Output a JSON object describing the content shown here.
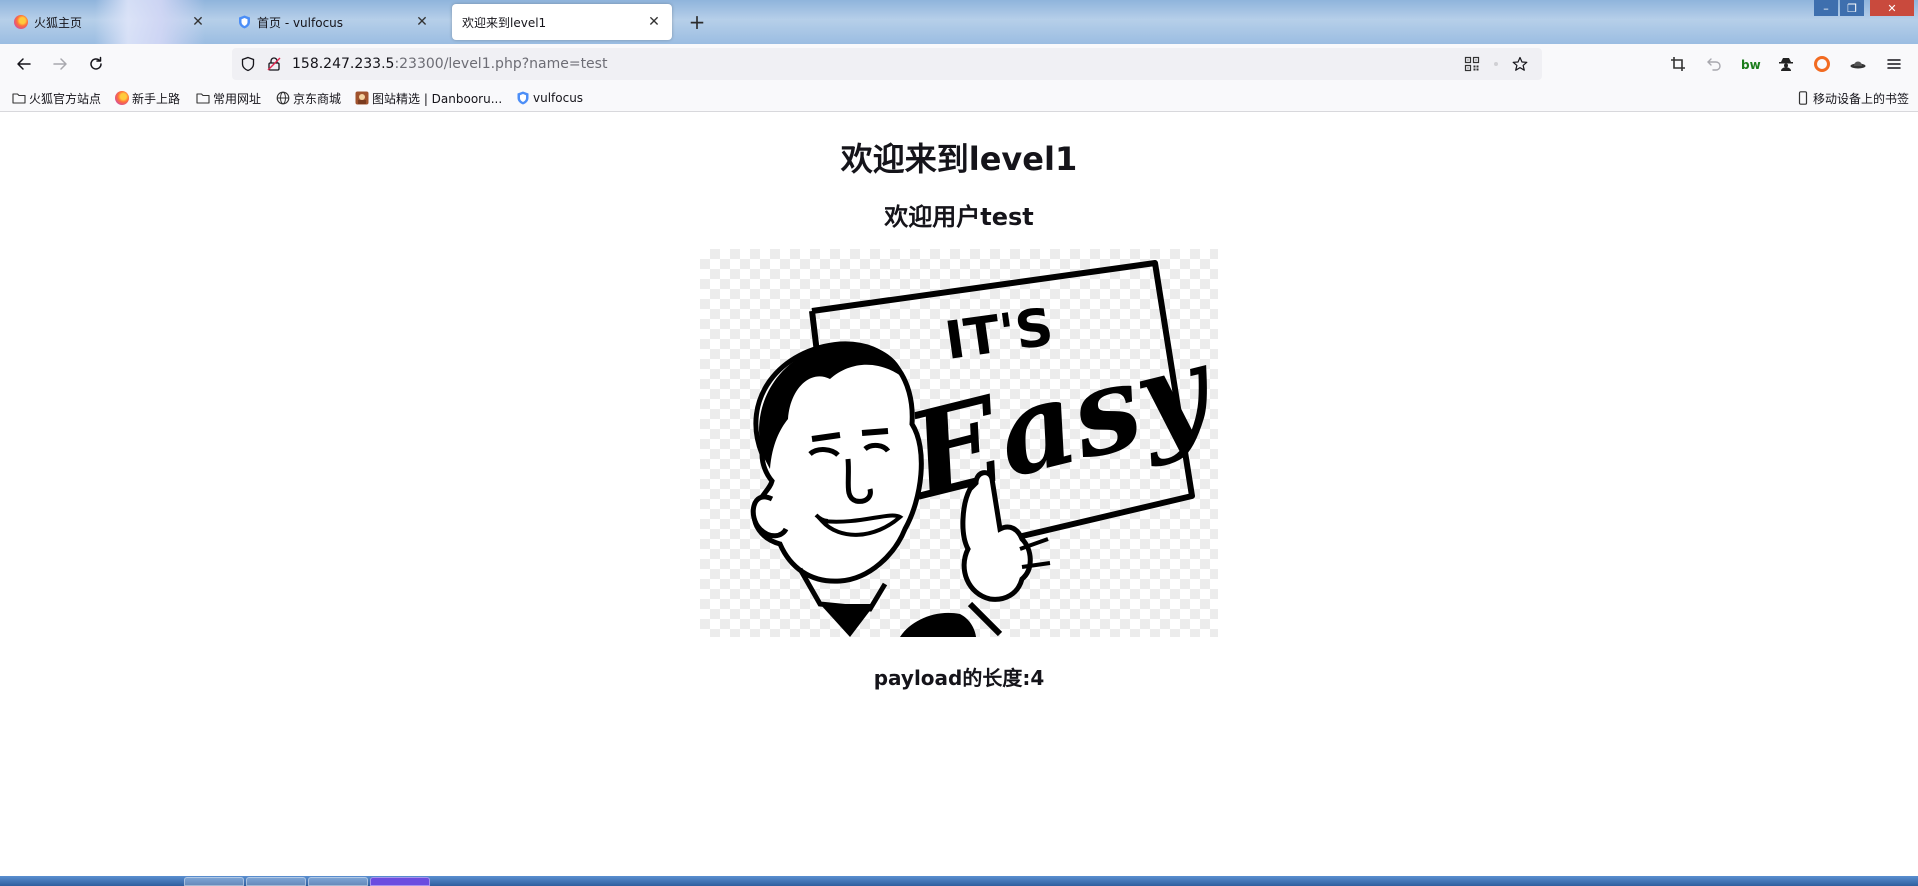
{
  "window": {
    "minimize_label": "–",
    "maximize_label": "❐",
    "close_label": "✕"
  },
  "tabs": [
    {
      "label": "火狐主页",
      "icon": "firefox-icon",
      "active": false
    },
    {
      "label": "首页 - vulfocus",
      "icon": "shield-icon",
      "active": false
    },
    {
      "label": "欢迎来到level1",
      "icon": "",
      "active": true
    }
  ],
  "tab_close_label": "✕",
  "new_tab_label": "+",
  "address": {
    "host": "158.247.233.5",
    "rest": ":23300/level1.php?name=test"
  },
  "bookmarks": [
    {
      "label": "火狐官方站点",
      "icon": "folder-icon"
    },
    {
      "label": "新手上路",
      "icon": "firefox-icon"
    },
    {
      "label": "常用网址",
      "icon": "folder-icon"
    },
    {
      "label": "京东商城",
      "icon": "globe-icon"
    },
    {
      "label": "图站精选 | Danbooru...",
      "icon": "danbooru-icon"
    },
    {
      "label": "vulfocus",
      "icon": "shield-icon"
    }
  ],
  "mobile_bookmarks": "移动设备上的书签",
  "page": {
    "title": "欢迎来到level1",
    "welcome": "欢迎用户test",
    "payload_length": "payload的长度:4",
    "image_alt": "It's Easy cartoon"
  },
  "colors": {
    "tab_strip": "#9bbde2",
    "active_tab": "#ffffff",
    "toolbar": "#f9f9fb",
    "urlbar": "#f0f0f4"
  }
}
